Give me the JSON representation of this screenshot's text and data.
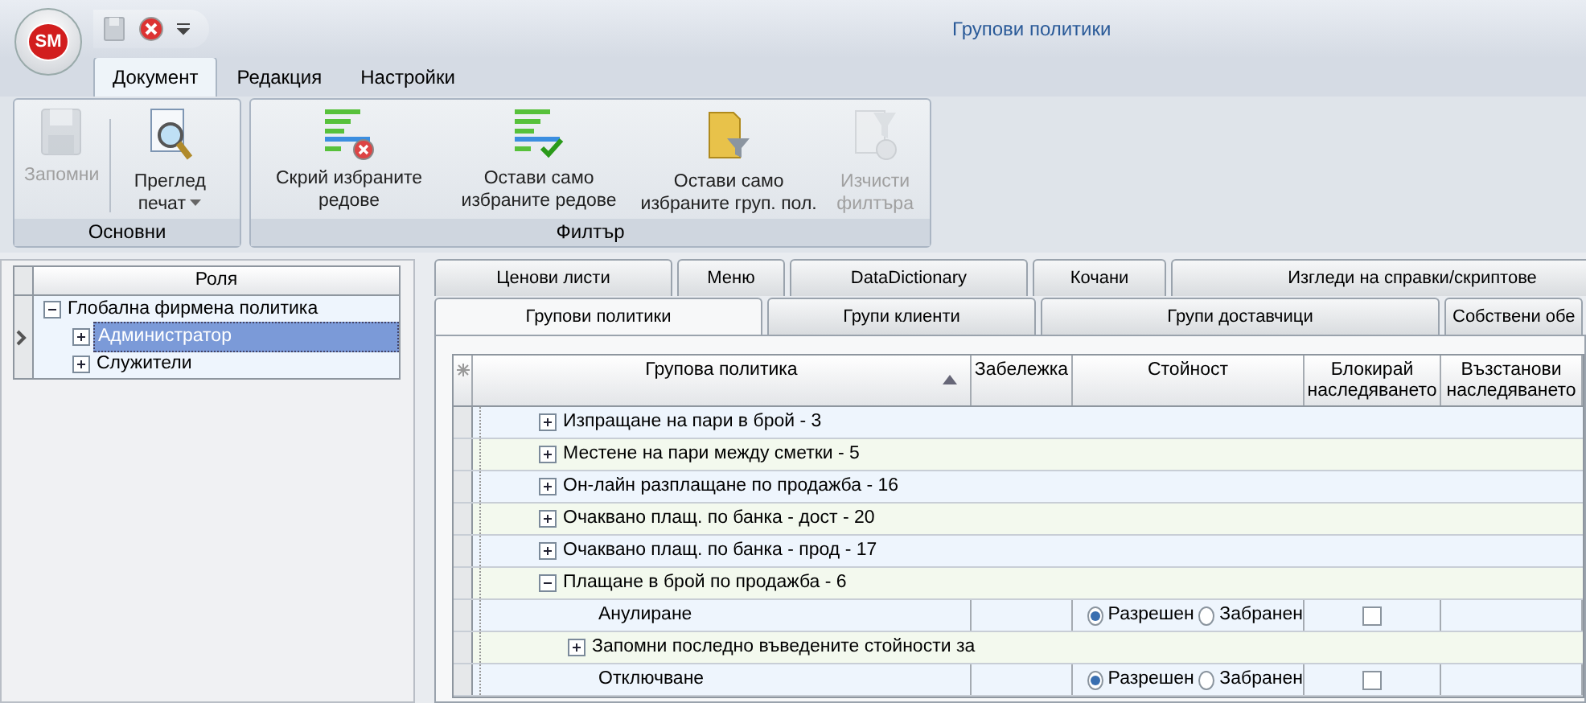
{
  "window": {
    "title": "Групови политики",
    "app_button": "SM"
  },
  "ribbon": {
    "tabs": [
      {
        "label": "Документ",
        "selected": true
      },
      {
        "label": "Редакция",
        "selected": false
      },
      {
        "label": "Настройки",
        "selected": false
      }
    ],
    "groups": [
      {
        "label": "Основни",
        "buttons": [
          {
            "label": "Запомни",
            "disabled": true,
            "dropdown": false
          },
          {
            "label": "Преглед печат",
            "disabled": false,
            "dropdown": true
          }
        ]
      },
      {
        "label": "Филтър",
        "buttons": [
          {
            "label": "Скрий избраните редове",
            "disabled": false,
            "dropdown": false
          },
          {
            "label": "Остави само избраните редове",
            "disabled": false,
            "dropdown": false
          },
          {
            "label": "Остави само избраните груп. пол.",
            "disabled": false,
            "dropdown": false
          },
          {
            "label": "Изчисти филтъра",
            "disabled": true,
            "dropdown": false
          }
        ]
      }
    ]
  },
  "roles": {
    "column": "Роля",
    "tree": [
      {
        "label": "Глобална фирмена политика",
        "expanded": true,
        "selected": false,
        "children": [
          {
            "label": "Администратор",
            "expanded": false,
            "selected": true
          },
          {
            "label": "Служители",
            "expanded": false,
            "selected": false
          }
        ]
      }
    ]
  },
  "tab_rows": [
    [
      {
        "label": "Ценови листи",
        "selected": false
      },
      {
        "label": "Меню",
        "selected": false
      },
      {
        "label": "DataDictionary",
        "selected": false
      },
      {
        "label": "Кочани",
        "selected": false
      },
      {
        "label": "Изгледи на справки/скриптове",
        "selected": false
      }
    ],
    [
      {
        "label": "Групови политики",
        "selected": true
      },
      {
        "label": "Групи клиенти",
        "selected": false
      },
      {
        "label": "Групи доставчици",
        "selected": false
      },
      {
        "label": "Собствени обе",
        "selected": false
      }
    ]
  ],
  "grid": {
    "columns": [
      "Групова политика",
      "Забележка",
      "Стойност",
      "Блокирай наследяването",
      "Възстанови наследяването"
    ],
    "rows": [
      {
        "kind": "group",
        "label": "Изпращане на пари в брой - 3",
        "expanded": false
      },
      {
        "kind": "group",
        "label": "Местене на пари между сметки - 5",
        "expanded": false
      },
      {
        "kind": "group",
        "label": "Он-лайн разплащане по продажба - 16",
        "expanded": false
      },
      {
        "kind": "group",
        "label": "Очаквано плащ. по банка - дост - 20",
        "expanded": false
      },
      {
        "kind": "group",
        "label": "Очаквано плащ. по банка - прод - 17",
        "expanded": false
      },
      {
        "kind": "group",
        "label": "Плащане в брой по продажба - 6",
        "expanded": true,
        "children": [
          {
            "kind": "setting",
            "label": "Анулиране",
            "options": [
              {
                "label": "Разрешен",
                "selected": true
              },
              {
                "label": "Забранен",
                "selected": false
              }
            ],
            "blocked": false
          },
          {
            "kind": "group",
            "label": "Запомни последно въведените стойности за",
            "expanded": false
          },
          {
            "kind": "setting",
            "label": "Отключване",
            "options": [
              {
                "label": "Разрешен",
                "selected": true
              },
              {
                "label": "Забранен",
                "selected": false
              }
            ],
            "blocked": false
          }
        ]
      }
    ]
  }
}
